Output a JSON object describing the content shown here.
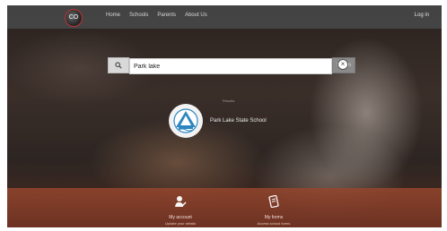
{
  "header": {
    "logo_text": "CO",
    "nav_items": [
      "Home",
      "Schools",
      "Parents",
      "About Us"
    ],
    "login_label": "Log in"
  },
  "search": {
    "value": "Park lake",
    "placeholder": "",
    "button_label": "Search"
  },
  "result": {
    "section_label": "Results",
    "school_name": "Park Lake State School"
  },
  "features": [
    {
      "title": "My account",
      "subtitle": "Update your details"
    },
    {
      "title": "My forms",
      "subtitle": "Access school forms"
    }
  ],
  "colors": {
    "topbar": "#464648",
    "search_button": "#8a8a8a",
    "badge_blue": "#2e86c1",
    "bottom_band": "#8f4630"
  }
}
